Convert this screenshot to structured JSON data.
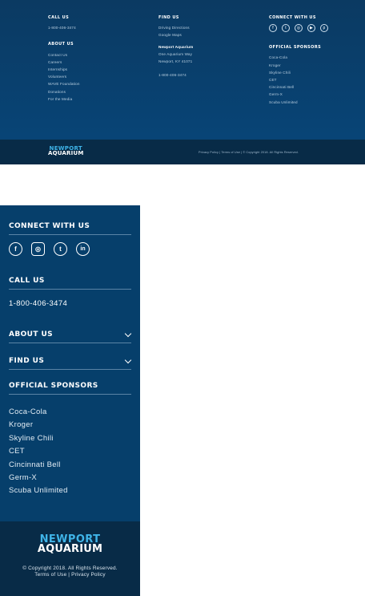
{
  "desktop": {
    "call_us": {
      "heading": "CALL US",
      "phone": "1-800-406-3474"
    },
    "about_us": {
      "heading": "ABOUT US",
      "links": [
        "Contact Us",
        "Careers",
        "Internships",
        "Volunteers",
        "WAVE Foundation",
        "Donations",
        "For the Media"
      ]
    },
    "find_us": {
      "heading": "FIND US",
      "links": [
        "Driving Directions",
        "Google Maps"
      ],
      "name": "Newport Aquarium",
      "address1": "One Aquarium Way",
      "address2": "Newport, KY 41071",
      "phone": "1-800-406-3474"
    },
    "connect": {
      "heading": "CONNECT WITH US",
      "icons": [
        "facebook-icon",
        "twitter-icon",
        "instagram-icon",
        "youtube-icon",
        "pinterest-icon"
      ]
    },
    "sponsors": {
      "heading": "OFFICIAL SPONSORS",
      "items": [
        "Coca-Cola",
        "Kroger",
        "Skyline Chili",
        "CET",
        "Cincinnati Bell",
        "Germ-X",
        "Scuba Unlimited"
      ]
    },
    "bottom": {
      "logo_line1": "NEWPORT",
      "logo_line2": "AQUARIUM",
      "privacy": "Privacy Policy",
      "sep1": " | ",
      "terms": "Terms of Use",
      "sep2": " | ",
      "copyright": "© Copyright 2018. All Rights Reserved."
    }
  },
  "mobile": {
    "connect": {
      "heading": "CONNECT WITH US",
      "icons": [
        "facebook-icon",
        "instagram-icon",
        "twitter-icon",
        "linkedin-icon"
      ]
    },
    "call_us": {
      "heading": "CALL US",
      "phone": "1-800-406-3474"
    },
    "about_us": {
      "heading": "ABOUT US"
    },
    "find_us": {
      "heading": "FIND US"
    },
    "sponsors": {
      "heading": "OFFICIAL SPONSORS",
      "items": [
        "Coca-Cola",
        "Kroger",
        "Skyline Chili",
        "CET",
        "Cincinnati Bell",
        "Germ-X",
        "Scuba Unlimited"
      ]
    },
    "bottom": {
      "logo_line1": "NEWPORT",
      "logo_line2": "AQUARIUM",
      "copyright": "© Copyright 2018. All Rights Reserved.",
      "terms": "Terms of Use",
      "sep": " | ",
      "privacy": "Privacy Policy"
    }
  },
  "colors": {
    "footer_blue": "#063f6b",
    "footer_dark": "#082b47",
    "logo_accent": "#3fb4e8"
  }
}
